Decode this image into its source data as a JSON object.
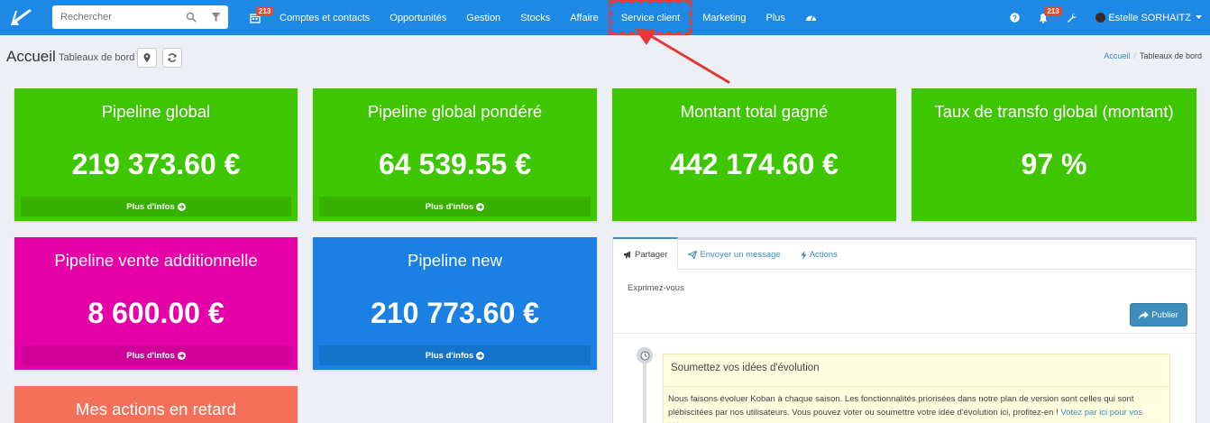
{
  "navbar": {
    "search_placeholder": "Rechercher",
    "calendar_badge": "213",
    "items": [
      {
        "label": "Comptes et contacts"
      },
      {
        "label": "Opportunités"
      },
      {
        "label": "Gestion"
      },
      {
        "label": "Stocks"
      },
      {
        "label": "Affaire"
      },
      {
        "label": "Service client"
      },
      {
        "label": "Marketing"
      },
      {
        "label": "Plus"
      }
    ],
    "notif_badge": "213",
    "user_name": "Estelle SORHAITZ"
  },
  "header": {
    "title": "Accueil",
    "subtitle": "Tableaux de bord",
    "breadcrumb_home": "Accueil",
    "breadcrumb_current": "Tableaux de bord"
  },
  "kpis": [
    {
      "title": "Pipeline global",
      "value": "219 373.60 €",
      "more": "Plus d'infos",
      "color": "#3ec600"
    },
    {
      "title": "Pipeline global pondéré",
      "value": "64 539.55 €",
      "more": "Plus d'infos",
      "color": "#3ec600"
    },
    {
      "title": "Montant total gagné",
      "value": "442 174.60 €",
      "color": "#3ec600"
    },
    {
      "title": "Taux de transfo global (montant)",
      "value": "97 %",
      "color": "#3ec600"
    },
    {
      "title": "Pipeline vente additionnelle",
      "value": "8 600.00 €",
      "more": "Plus d'infos",
      "color": "#e600a8"
    },
    {
      "title": "Pipeline new",
      "value": "210 773.60 €",
      "more": "Plus d'infos",
      "color": "#1a80e3"
    },
    {
      "title": "Mes actions en retard",
      "color": "#f5705b"
    }
  ],
  "panel": {
    "tabs": [
      {
        "label": "Partager"
      },
      {
        "label": "Envoyer un message"
      },
      {
        "label": "Actions"
      }
    ],
    "share_placeholder": "Exprimez-vous",
    "publish_label": "Publier",
    "idea_title": "Soumettez vos idées d'évolution",
    "idea_body": "Nous faisons évoluer Koban à chaque saison. Les fonctionnalités priorisées dans notre plan de version sont celles qui sont plébiscitées par nos utilisateurs. Vous pouvez voter ou soumettre votre idée d'évolution ici, profitez-en ! ",
    "idea_link": "Votez par ici pour vos idées"
  },
  "colors": {
    "navbar": "#1e88e5",
    "accent": "#3c8dbc",
    "annotation": "#e53935"
  }
}
